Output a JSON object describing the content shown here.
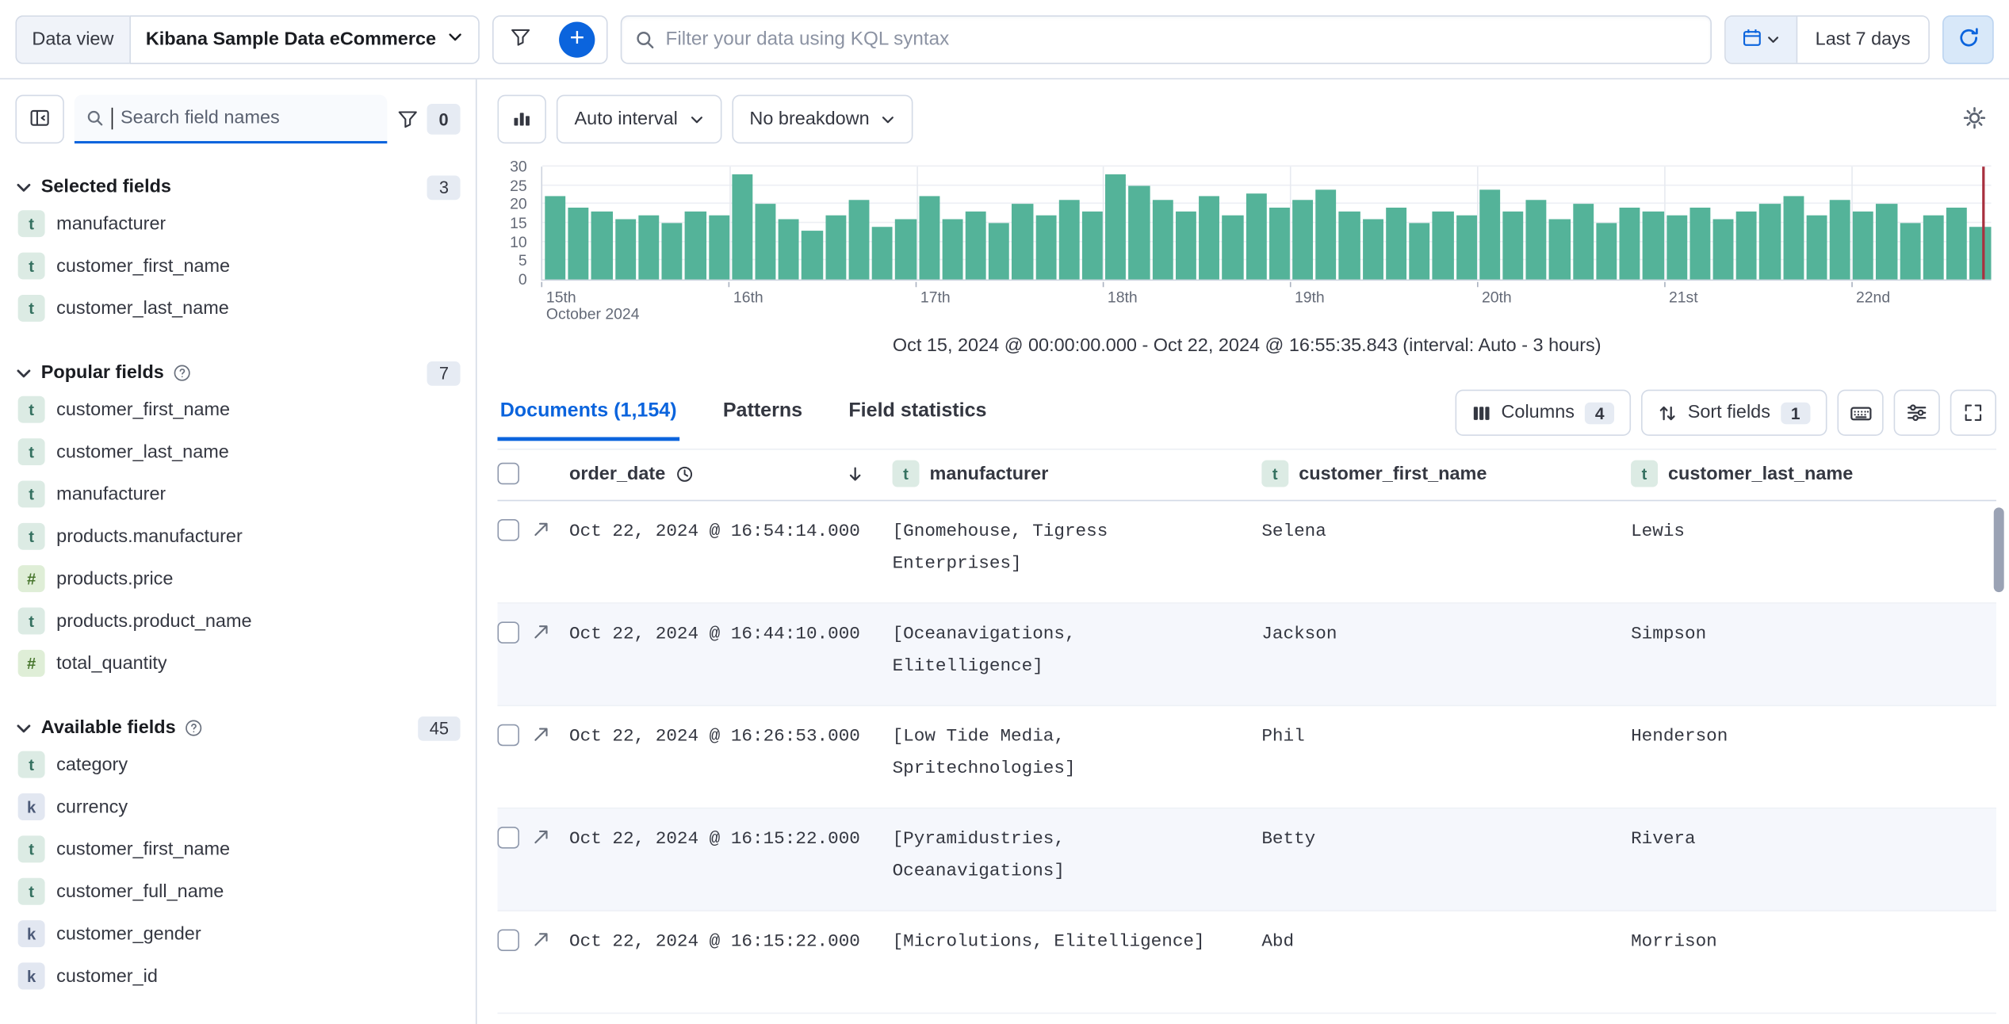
{
  "topbar": {
    "data_view_label": "Data view",
    "data_view_value": "Kibana Sample Data eCommerce",
    "kql_placeholder": "Filter your data using KQL syntax",
    "time_range_label": "Last 7 days"
  },
  "sidebar": {
    "search_placeholder": "Search field names",
    "filter_count": "0",
    "sections": [
      {
        "label": "Selected fields",
        "count": "3",
        "help": false,
        "fields": [
          {
            "token": "t",
            "name": "manufacturer"
          },
          {
            "token": "t",
            "name": "customer_first_name"
          },
          {
            "token": "t",
            "name": "customer_last_name"
          }
        ]
      },
      {
        "label": "Popular fields",
        "count": "7",
        "help": true,
        "fields": [
          {
            "token": "t",
            "name": "customer_first_name"
          },
          {
            "token": "t",
            "name": "customer_last_name"
          },
          {
            "token": "t",
            "name": "manufacturer"
          },
          {
            "token": "t",
            "name": "products.manufacturer"
          },
          {
            "token": "#",
            "name": "products.price"
          },
          {
            "token": "t",
            "name": "products.product_name"
          },
          {
            "token": "#",
            "name": "total_quantity"
          }
        ]
      },
      {
        "label": "Available fields",
        "count": "45",
        "help": true,
        "fields": [
          {
            "token": "t",
            "name": "category"
          },
          {
            "token": "k",
            "name": "currency"
          },
          {
            "token": "t",
            "name": "customer_first_name"
          },
          {
            "token": "t",
            "name": "customer_full_name"
          },
          {
            "token": "k",
            "name": "customer_gender"
          },
          {
            "token": "k",
            "name": "customer_id"
          }
        ]
      }
    ]
  },
  "chart": {
    "interval_label": "Auto interval",
    "breakdown_label": "No breakdown",
    "caption": "Oct 15, 2024 @ 00:00:00.000 - Oct 22, 2024 @ 16:55:35.843 (interval: Auto - 3 hours)"
  },
  "chart_data": {
    "type": "bar",
    "ylim": [
      0,
      30
    ],
    "yticks": [
      0,
      5,
      10,
      15,
      20,
      25,
      30
    ],
    "x_tick_labels": [
      "15th",
      "16th",
      "17th",
      "18th",
      "19th",
      "20th",
      "21st",
      "22nd"
    ],
    "x_axis_secondary_label": "October 2024",
    "bars_per_day": 8,
    "bar_color": "#54b399",
    "current_time_marker_color": "#a8303f",
    "values": [
      22,
      19,
      18,
      16,
      17,
      15,
      18,
      17,
      28,
      20,
      16,
      13,
      17,
      21,
      14,
      16,
      22,
      16,
      18,
      15,
      20,
      17,
      21,
      18,
      28,
      25,
      21,
      18,
      22,
      17,
      23,
      19,
      21,
      24,
      18,
      16,
      19,
      15,
      18,
      17,
      24,
      18,
      21,
      16,
      20,
      15,
      19,
      18,
      17,
      19,
      16,
      18,
      20,
      22,
      17,
      21,
      18,
      20,
      15,
      17,
      19,
      14
    ]
  },
  "tabs": [
    {
      "label": "Documents (1,154)",
      "active": true
    },
    {
      "label": "Patterns",
      "active": false
    },
    {
      "label": "Field statistics",
      "active": false
    }
  ],
  "toolbar": {
    "columns_label": "Columns",
    "columns_count": "4",
    "sort_label": "Sort fields",
    "sort_count": "1"
  },
  "table": {
    "columns": [
      {
        "label": "order_date",
        "icon": "clock",
        "sorted": "desc"
      },
      {
        "label": "manufacturer",
        "token": "t"
      },
      {
        "label": "customer_first_name",
        "token": "t"
      },
      {
        "label": "customer_last_name",
        "token": "t"
      }
    ],
    "rows": [
      {
        "order_date": "Oct 22, 2024 @ 16:54:14.000",
        "manufacturer": "[Gnomehouse, Tigress Enterprises]",
        "customer_first_name": "Selena",
        "customer_last_name": "Lewis"
      },
      {
        "order_date": "Oct 22, 2024 @ 16:44:10.000",
        "manufacturer": "[Oceanavigations, Elitelligence]",
        "customer_first_name": "Jackson",
        "customer_last_name": "Simpson"
      },
      {
        "order_date": "Oct 22, 2024 @ 16:26:53.000",
        "manufacturer": "[Low Tide Media, Spritechnologies]",
        "customer_first_name": "Phil",
        "customer_last_name": "Henderson"
      },
      {
        "order_date": "Oct 22, 2024 @ 16:15:22.000",
        "manufacturer": "[Pyramidustries, Oceanavigations]",
        "customer_first_name": "Betty",
        "customer_last_name": "Rivera"
      },
      {
        "order_date": "Oct 22, 2024 @ 16:15:22.000",
        "manufacturer": "[Microlutions, Elitelligence]",
        "customer_first_name": "Abd",
        "customer_last_name": "Morrison"
      }
    ]
  }
}
